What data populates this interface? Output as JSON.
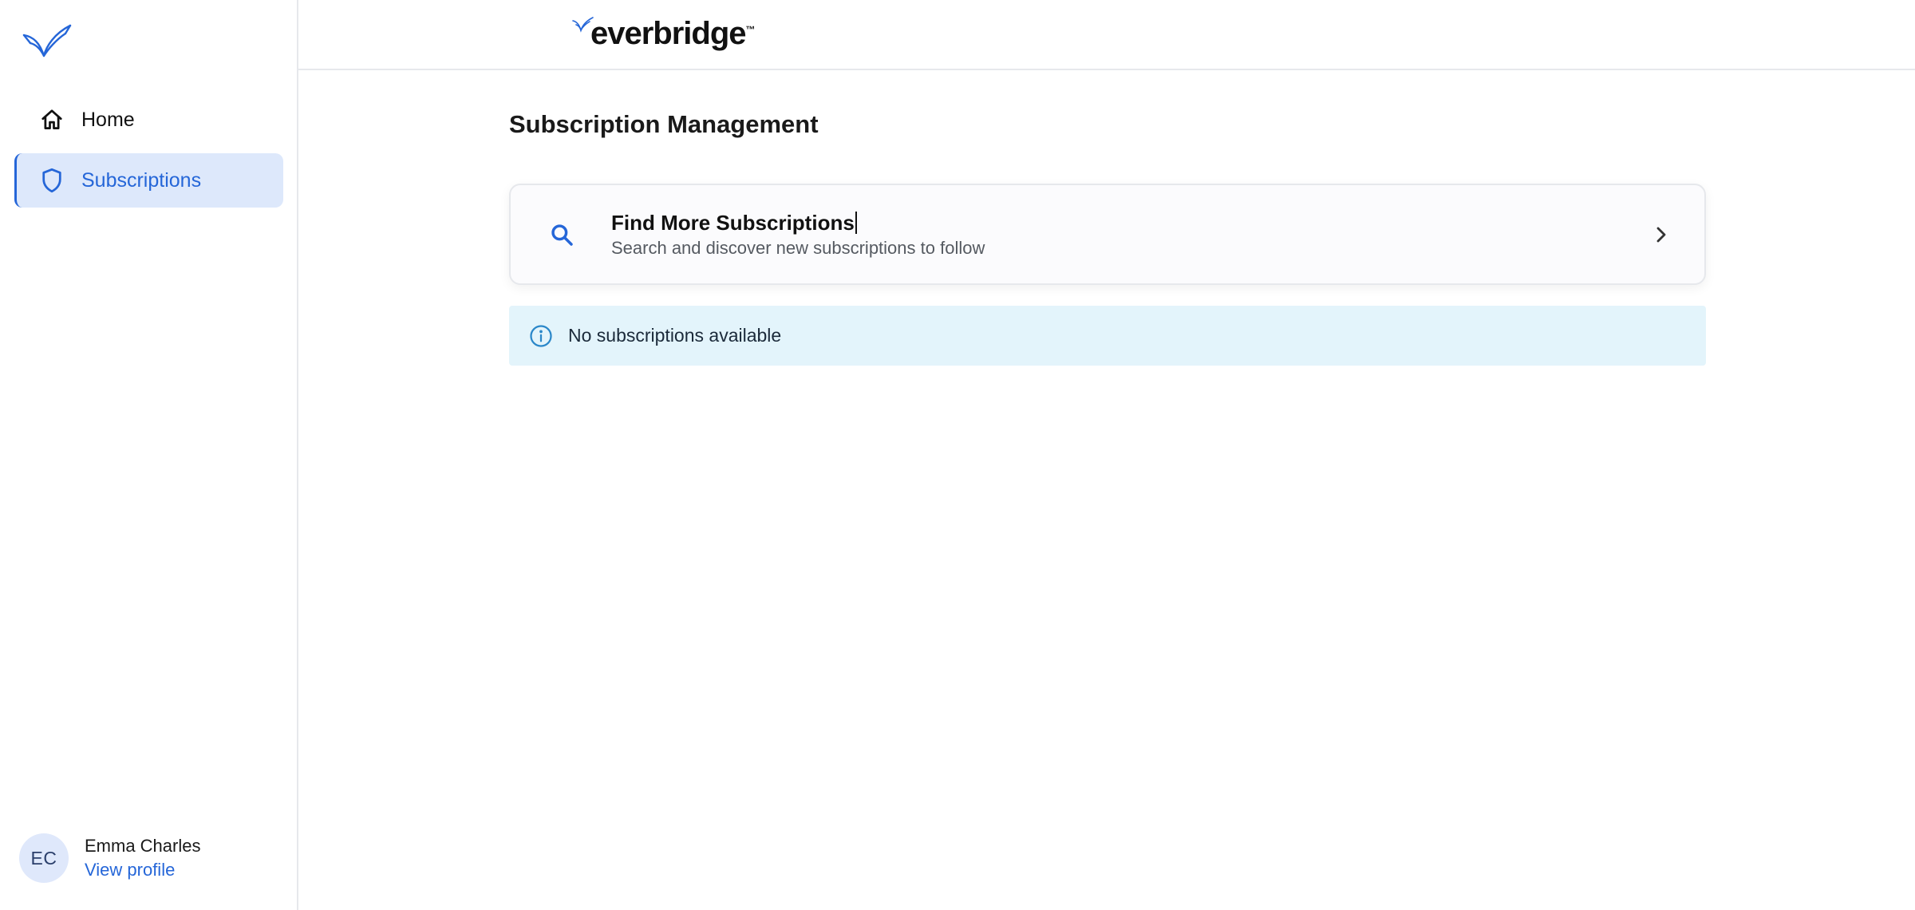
{
  "brand": {
    "name": "everbridge",
    "trademark": "™"
  },
  "sidebar": {
    "items": [
      {
        "label": "Home",
        "icon": "home-icon",
        "active": false
      },
      {
        "label": "Subscriptions",
        "icon": "shield-icon",
        "active": true
      }
    ]
  },
  "profile": {
    "initials": "EC",
    "name": "Emma Charles",
    "link_label": "View profile"
  },
  "main": {
    "title": "Subscription Management",
    "find_card": {
      "title": "Find More Subscriptions",
      "subtitle": "Search and discover new subscriptions to follow",
      "icon": "search-icon"
    },
    "info_banner": {
      "text": "No subscriptions available",
      "icon": "info-icon"
    }
  },
  "colors": {
    "accent": "#2566d8",
    "active_nav_bg": "#dde8fb",
    "info_bg": "#e3f4fb",
    "border": "#e6e8ec"
  }
}
